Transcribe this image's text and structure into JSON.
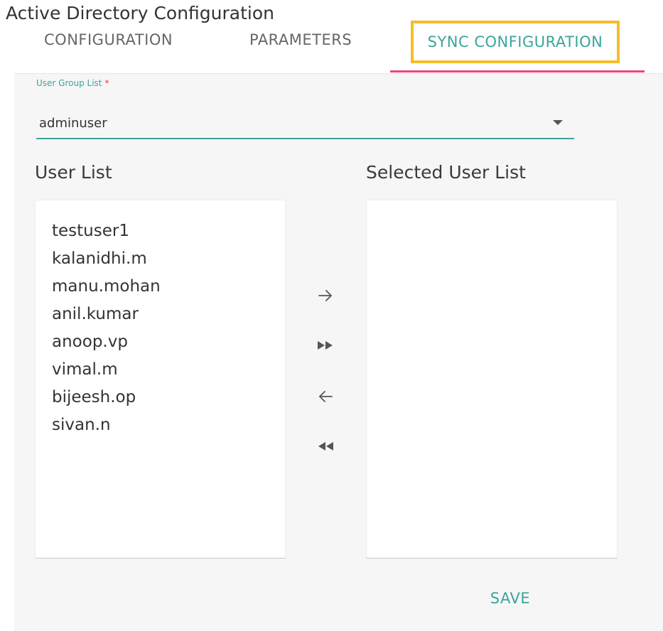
{
  "page": {
    "title": "Active Directory Configuration"
  },
  "tabs": [
    {
      "label": "CONFIGURATION",
      "active": false
    },
    {
      "label": "PARAMETERS",
      "active": false
    },
    {
      "label": "SYNC CONFIGURATION",
      "active": true
    }
  ],
  "colors": {
    "accent": "#3aa59a",
    "tab_indicator": "#f0437a",
    "highlight_box": "#f4bd2a",
    "required": "#e53935"
  },
  "user_group": {
    "label": "User Group List",
    "required_marker": "*",
    "value": "adminuser"
  },
  "user_list": {
    "heading": "User List",
    "items": [
      "testuser1",
      "kalanidhi.m",
      "manu.mohan",
      "anil.kumar",
      "anoop.vp",
      "vimal.m",
      "bijeesh.op",
      "sivan.n"
    ]
  },
  "selected_user_list": {
    "heading": "Selected User List",
    "items": []
  },
  "transfer_buttons": [
    {
      "icon": "arrow-right-icon"
    },
    {
      "icon": "double-right-icon"
    },
    {
      "icon": "arrow-left-icon"
    },
    {
      "icon": "double-left-icon"
    }
  ],
  "actions": {
    "save_label": "SAVE"
  }
}
